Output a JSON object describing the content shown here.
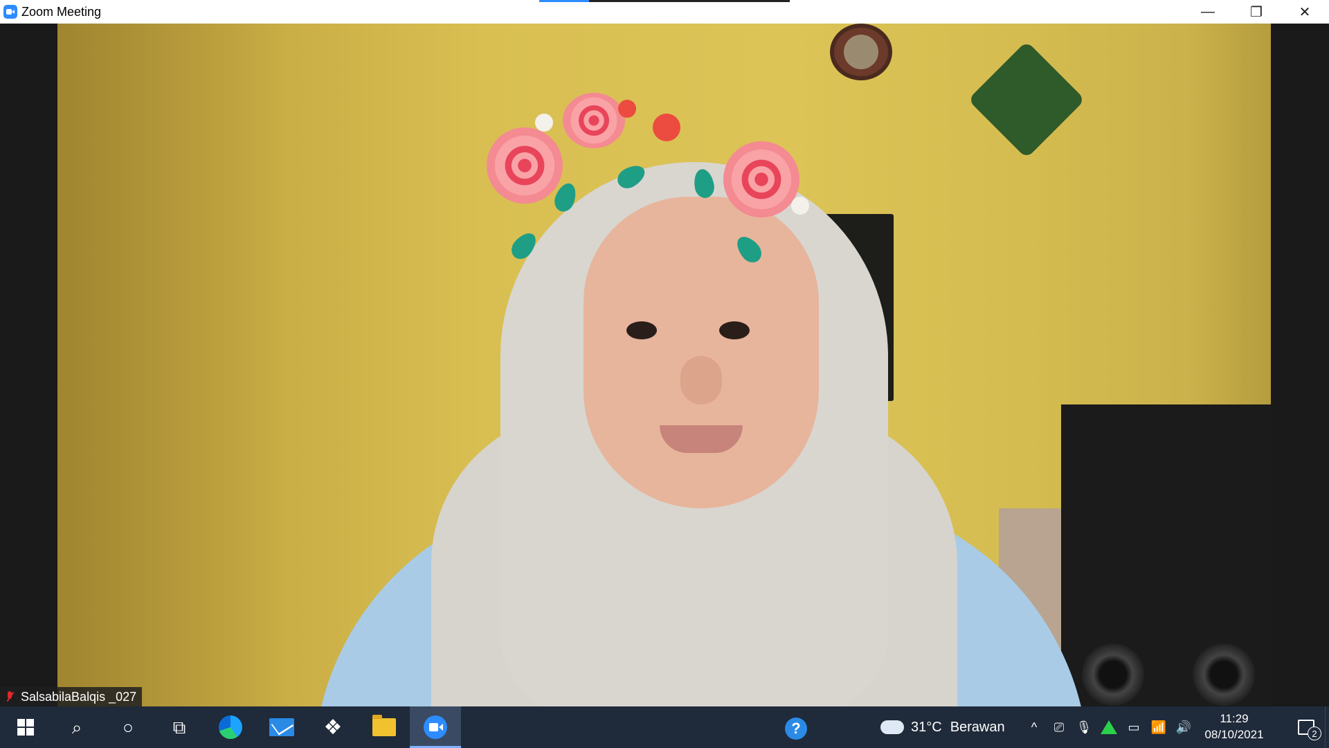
{
  "window": {
    "title": "Zoom Meeting",
    "minimize_glyph": "—",
    "restore_glyph": "❐",
    "close_glyph": "✕",
    "top_progress": 0.2
  },
  "participant": {
    "name": "SalsabilaBalqis _027",
    "mic_muted": true
  },
  "taskbar": {
    "items": [
      {
        "name": "start",
        "icon": "windows-start-icon"
      },
      {
        "name": "search",
        "icon": "search-icon",
        "glyph": "⌕"
      },
      {
        "name": "cortana",
        "icon": "cortana-icon",
        "glyph": "○"
      },
      {
        "name": "task-view",
        "icon": "task-view-icon",
        "glyph": "⧉"
      },
      {
        "name": "edge",
        "icon": "edge-icon"
      },
      {
        "name": "mail",
        "icon": "mail-icon"
      },
      {
        "name": "dropbox",
        "icon": "dropbox-icon",
        "glyph": "❖"
      },
      {
        "name": "file-explorer",
        "icon": "folder-icon"
      },
      {
        "name": "zoom",
        "icon": "zoom-icon",
        "active": true
      }
    ],
    "help_glyph": "?",
    "weather": {
      "temp": "31°C",
      "condition": "Berawan"
    },
    "tray": {
      "chevron_glyph": "^",
      "meet_glyph": "⎚",
      "mic_glyph": "🎙",
      "battery_glyph": "▭",
      "wifi_glyph": "📶",
      "volume_glyph": "🔊"
    },
    "time": "11:29",
    "date": "08/10/2021",
    "notification_count": "2"
  },
  "colors": {
    "zoom_blue": "#2d8cff",
    "taskbar_bg": "#1f2a3a",
    "muted_red": "#e02828"
  }
}
